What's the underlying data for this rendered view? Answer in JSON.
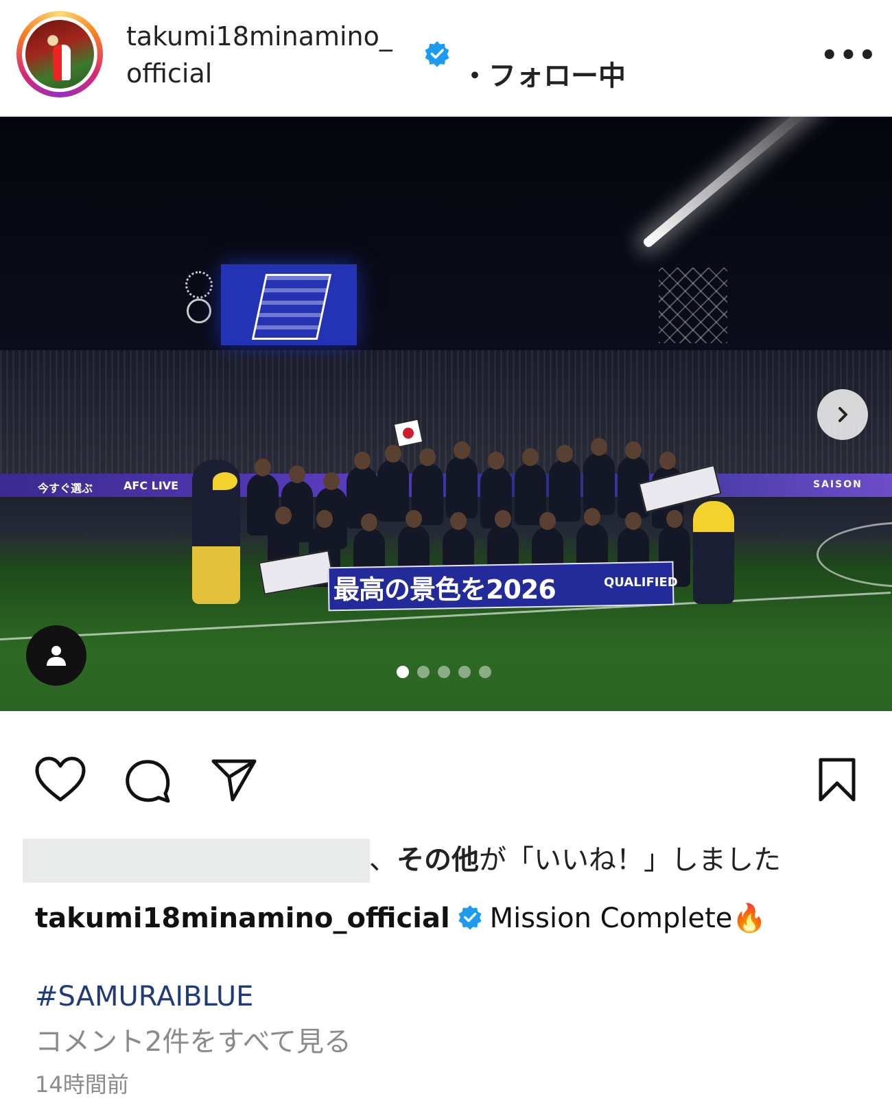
{
  "header": {
    "username_line1": "takumi18minamino_",
    "username_line2": "official",
    "follow_status": "・フォロー中",
    "more_label": "•••",
    "verified_color": "#1d9bf0"
  },
  "post": {
    "carousel": {
      "total_images": 5,
      "active_index": 0
    },
    "photo_text": {
      "banner_main": "最高の景色を2026",
      "banner_badge": "QUALIFIED",
      "ad_left": "今すぐ選ぶ",
      "ad_middle": "AFC LIVE",
      "ad_right": "SAISON"
    },
    "icons": {
      "next": "chevron-right-icon",
      "tag": "user-tag-icon",
      "like": "heart-icon",
      "comment": "comment-icon",
      "share": "send-icon",
      "save": "bookmark-icon"
    }
  },
  "likes": {
    "suffix": "、",
    "others_bold": "その他",
    "liked_text": "が「いいね！」しました"
  },
  "caption": {
    "username": "takumi18minamino_official",
    "text": "Mission Complete🔥",
    "hashtag": "#SAMURAIBLUE"
  },
  "comments": {
    "view_all_label": "コメント2件をすべて見る"
  },
  "meta": {
    "time_ago": "14時間前"
  }
}
